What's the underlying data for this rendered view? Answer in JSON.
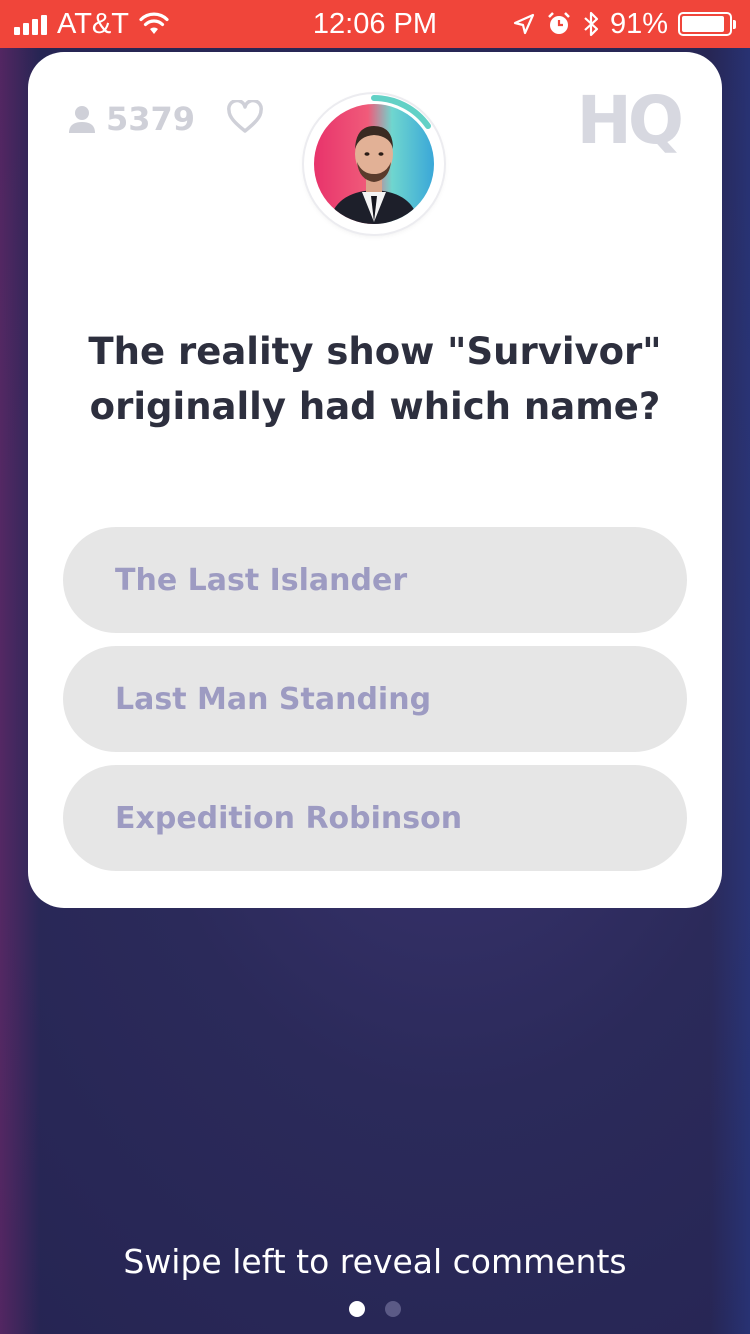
{
  "status_bar": {
    "carrier": "AT&T",
    "time": "12:06 PM",
    "battery_percent": "91%",
    "battery_level": 0.91,
    "icons": [
      "signal-icon",
      "wifi-icon",
      "location-arrow-icon",
      "alarm-clock-icon",
      "bluetooth-icon",
      "battery-icon"
    ]
  },
  "card": {
    "player_count": "5379",
    "logo_text": "HQ",
    "question": {
      "line1": "The reality show \"Survivor\"",
      "line2": "originally had which name?"
    },
    "answers": [
      {
        "label": "The Last Islander"
      },
      {
        "label": "Last Man Standing"
      },
      {
        "label": "Expedition Robinson"
      }
    ]
  },
  "footer": {
    "swipe_hint": "Swipe left to reveal comments",
    "page_count": 2,
    "active_page": 1
  },
  "colors": {
    "status_bar": "#f0453a",
    "background": "#2b2a5a",
    "answer_pill": "#e6e6e6",
    "answer_text": "#9d9bc2",
    "question_text": "#2d2f3e"
  }
}
